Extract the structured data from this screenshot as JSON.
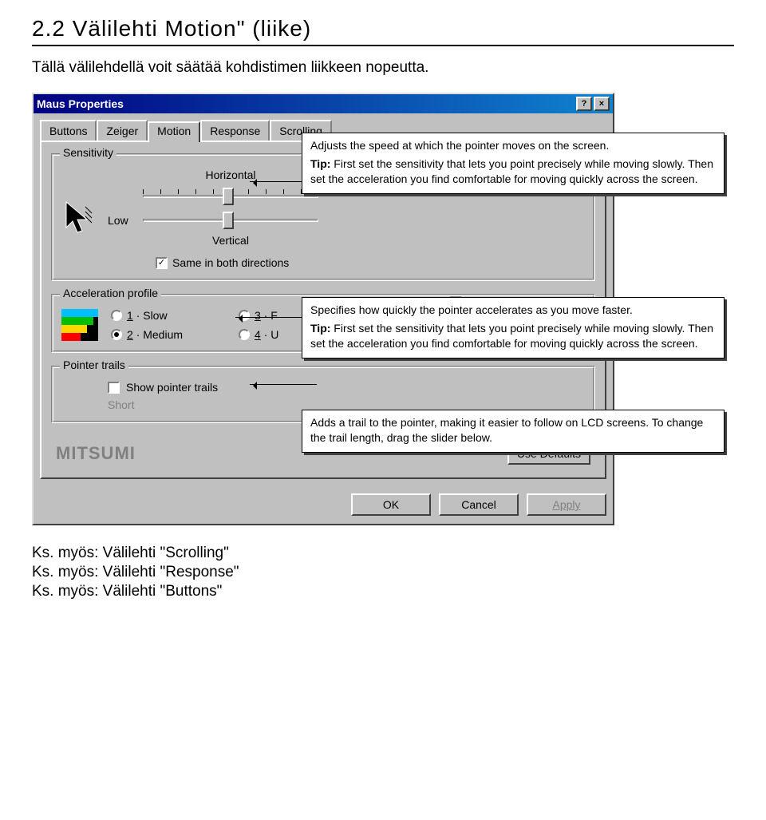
{
  "page": {
    "heading": "2.2 Välilehti Motion\" (liike)",
    "description": "Tällä välilehdellä voit säätää kohdistimen liikkeen nopeutta.",
    "see_also_1": "Ks. myös: Välilehti \"Scrolling\"",
    "see_also_2": "Ks. myös: Välilehti \"Response\"",
    "see_also_3": "Ks. myös: Välilehti \"Buttons\""
  },
  "dialog": {
    "title": "Maus Properties",
    "help_btn": "?",
    "close_btn": "×"
  },
  "tabs": {
    "buttons": "Buttons",
    "zeiger": "Zeiger",
    "motion": "Motion",
    "response": "Response",
    "scrolling": "Scrolling"
  },
  "sensitivity": {
    "group": "Sensitivity",
    "horizontal": "Horizontal",
    "vertical": "Vertical",
    "low": "Low",
    "same_both": "Same in both directions",
    "same_both_checked": true,
    "same_both_fragment": "same in both directions"
  },
  "accel": {
    "group": "Acceleration profile",
    "opt1_pre": "1",
    "opt1": " · Slow",
    "opt2_pre": "2",
    "opt2": " · Medium",
    "opt3_pre": "3",
    "opt3": " · F",
    "opt4_pre": "4",
    "opt4": " · U",
    "selected": 2
  },
  "trails": {
    "group": "Pointer trails",
    "show": "Show pointer trails",
    "checked": false,
    "short": "Short"
  },
  "brand": "MITSUMI",
  "buttons": {
    "use_defaults": "Use Defaults",
    "ok": "OK",
    "cancel": "Cancel",
    "apply": "Apply"
  },
  "tooltips": {
    "sens_line1": "Adjusts the speed at which the pointer moves on the screen.",
    "sens_tip_label": "Tip:",
    "sens_tip": " First set the sensitivity that lets you point precisely while moving slowly. Then set the acceleration you find comfortable for moving quickly across the screen.",
    "accel_line1": "Specifies how quickly the pointer accelerates as you move faster.",
    "accel_tip_label": "Tip:",
    "accel_tip": " First set the sensitivity that lets you point precisely while moving slowly. Then set the acceleration you find comfortable for moving quickly across the screen.",
    "trails_line": "Adds a trail to the pointer, making it easier to follow on LCD screens. To change the trail length, drag the slider below."
  }
}
